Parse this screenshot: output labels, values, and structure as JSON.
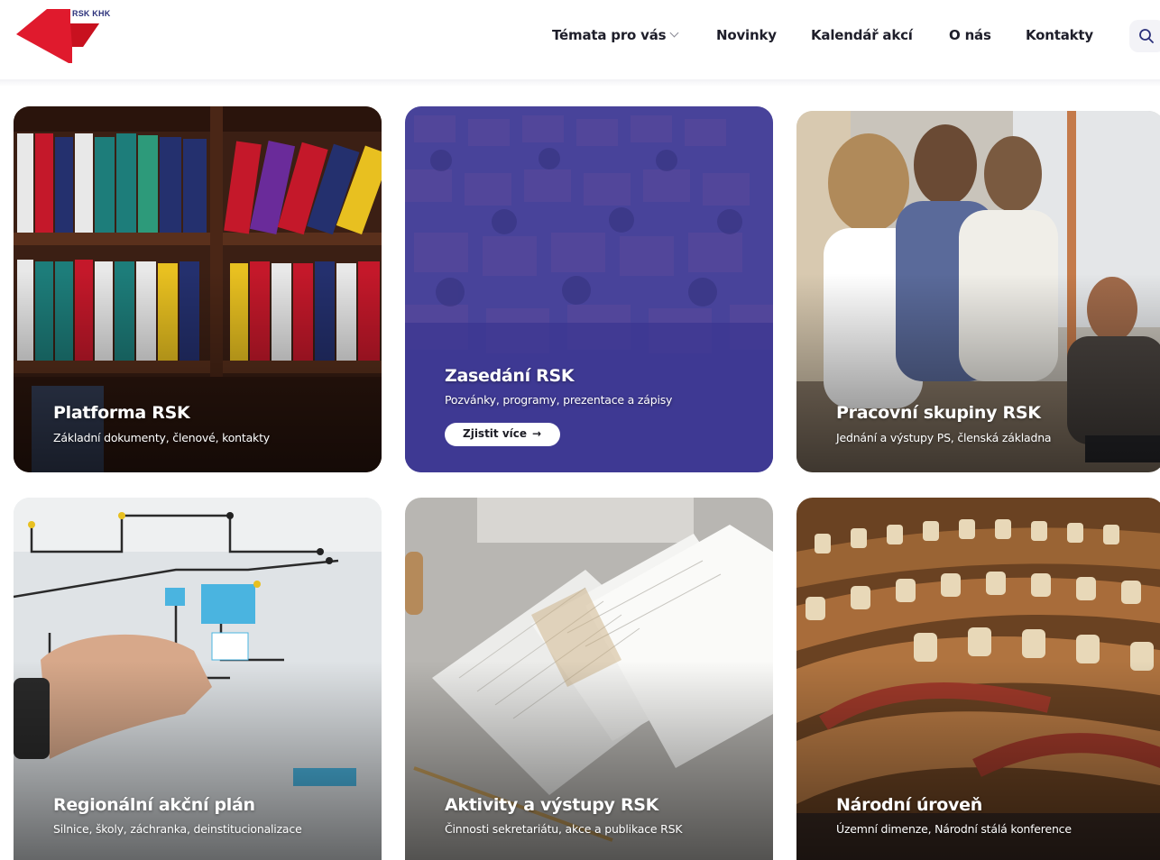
{
  "header": {
    "logo_text": "RSK KHK",
    "nav": [
      {
        "label": "Témata pro vás"
      },
      {
        "label": "Novinky"
      },
      {
        "label": "Kalendář akcí"
      },
      {
        "label": "O nás"
      },
      {
        "label": "Kontakty"
      }
    ],
    "search_icon": "search-icon"
  },
  "colors": {
    "logo_red": "#e01a2d",
    "brand_navy": "#2a2f7a",
    "overlay_blue": "#3a3a9a"
  },
  "cards": [
    {
      "title": "Platforma RSK",
      "subtitle": "Základní dokumenty, členové, kontakty"
    },
    {
      "title": "Zasedání RSK",
      "subtitle": "Pozvánky, programy, prezentace a zápisy",
      "button": "Zjistit více",
      "button_icon": "arrow-right-icon"
    },
    {
      "title": "Pracovní skupiny RSK",
      "subtitle": "Jednání a výstupy PS, členská základna"
    },
    {
      "title": "Regionální akční plán",
      "subtitle": "Silnice, školy, záchranka, deinstitucionalizace"
    },
    {
      "title": "Aktivity a výstupy RSK",
      "subtitle": "Činnosti sekretariátu, akce a publikace RSK"
    },
    {
      "title": "Národní úroveň",
      "subtitle": "Územní dimenze, Národní stálá konference"
    }
  ]
}
